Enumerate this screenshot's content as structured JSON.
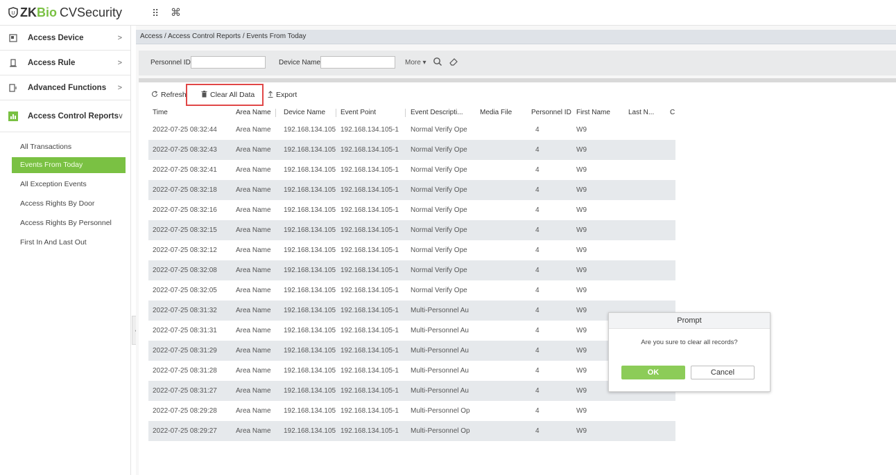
{
  "app": {
    "logo_zk": "ZK",
    "logo_bio": "Bio",
    "logo_cv": "CVSecurity"
  },
  "topbar": {
    "grid_icon": "⠿",
    "command_icon": "⌘"
  },
  "colors": {
    "accent": "#7ac143",
    "highlight": "#e04646",
    "ok_button": "#8ccc58"
  },
  "sidebar": {
    "menus": [
      {
        "label": "Access Device",
        "icon": "device-icon",
        "chevron": ">"
      },
      {
        "label": "Access Rule",
        "icon": "rule-icon",
        "chevron": ">"
      },
      {
        "label": "Advanced Functions",
        "icon": "advanced-icon",
        "chevron": ">"
      },
      {
        "label": "Access Control Reports",
        "icon": "reports-icon",
        "chevron": "∨"
      }
    ],
    "items": [
      {
        "label": "All Transactions"
      },
      {
        "label": "Events From Today"
      },
      {
        "label": "All Exception Events"
      },
      {
        "label": "Access Rights By Door"
      },
      {
        "label": "Access Rights By Personnel"
      },
      {
        "label": "First In And Last Out"
      }
    ],
    "collapse_glyph": "‹"
  },
  "breadcrumb": "Access / Access Control Reports / Events From Today",
  "search": {
    "personnel_id_label": "Personnel ID",
    "personnel_id_value": "",
    "device_name_label": "Device Name",
    "device_name_value": "",
    "more_label": "More ▾"
  },
  "toolbar": {
    "refresh_label": "Refresh",
    "clear_label": "Clear All Data",
    "export_label": "Export"
  },
  "table": {
    "headers": [
      "Time",
      "Area Name",
      "Device Name",
      "Event Point",
      "Event Descripti...",
      "Media File",
      "Personnel ID",
      "First Name",
      "Last N...",
      "C"
    ],
    "rows": [
      [
        "2022-07-25 08:32:44",
        "Area Name",
        "192.168.134.105",
        "192.168.134.105-1",
        "Normal Verify Ope",
        "",
        "4",
        "W9"
      ],
      [
        "2022-07-25 08:32:43",
        "Area Name",
        "192.168.134.105",
        "192.168.134.105-1",
        "Normal Verify Ope",
        "",
        "4",
        "W9"
      ],
      [
        "2022-07-25 08:32:41",
        "Area Name",
        "192.168.134.105",
        "192.168.134.105-1",
        "Normal Verify Ope",
        "",
        "4",
        "W9"
      ],
      [
        "2022-07-25 08:32:18",
        "Area Name",
        "192.168.134.105",
        "192.168.134.105-1",
        "Normal Verify Ope",
        "",
        "4",
        "W9"
      ],
      [
        "2022-07-25 08:32:16",
        "Area Name",
        "192.168.134.105",
        "192.168.134.105-1",
        "Normal Verify Ope",
        "",
        "4",
        "W9"
      ],
      [
        "2022-07-25 08:32:15",
        "Area Name",
        "192.168.134.105",
        "192.168.134.105-1",
        "Normal Verify Ope",
        "",
        "4",
        "W9"
      ],
      [
        "2022-07-25 08:32:12",
        "Area Name",
        "192.168.134.105",
        "192.168.134.105-1",
        "Normal Verify Ope",
        "",
        "4",
        "W9"
      ],
      [
        "2022-07-25 08:32:08",
        "Area Name",
        "192.168.134.105",
        "192.168.134.105-1",
        "Normal Verify Ope",
        "",
        "4",
        "W9"
      ],
      [
        "2022-07-25 08:32:05",
        "Area Name",
        "192.168.134.105",
        "192.168.134.105-1",
        "Normal Verify Ope",
        "",
        "4",
        "W9"
      ],
      [
        "2022-07-25 08:31:32",
        "Area Name",
        "192.168.134.105",
        "192.168.134.105-1",
        "Multi-Personnel Au",
        "",
        "4",
        "W9"
      ],
      [
        "2022-07-25 08:31:31",
        "Area Name",
        "192.168.134.105",
        "192.168.134.105-1",
        "Multi-Personnel Au",
        "",
        "4",
        "W9"
      ],
      [
        "2022-07-25 08:31:29",
        "Area Name",
        "192.168.134.105",
        "192.168.134.105-1",
        "Multi-Personnel Au",
        "",
        "4",
        "W9"
      ],
      [
        "2022-07-25 08:31:28",
        "Area Name",
        "192.168.134.105",
        "192.168.134.105-1",
        "Multi-Personnel Au",
        "",
        "4",
        "W9"
      ],
      [
        "2022-07-25 08:31:27",
        "Area Name",
        "192.168.134.105",
        "192.168.134.105-1",
        "Multi-Personnel Au",
        "",
        "4",
        "W9"
      ],
      [
        "2022-07-25 08:29:28",
        "Area Name",
        "192.168.134.105",
        "192.168.134.105-1",
        "Multi-Personnel Op",
        "",
        "4",
        "W9"
      ],
      [
        "2022-07-25 08:29:27",
        "Area Name",
        "192.168.134.105",
        "192.168.134.105-1",
        "Multi-Personnel Op",
        "",
        "4",
        "W9"
      ]
    ]
  },
  "dialog": {
    "title": "Prompt",
    "message": "Are you sure to clear all records?",
    "ok_label": "OK",
    "cancel_label": "Cancel"
  }
}
